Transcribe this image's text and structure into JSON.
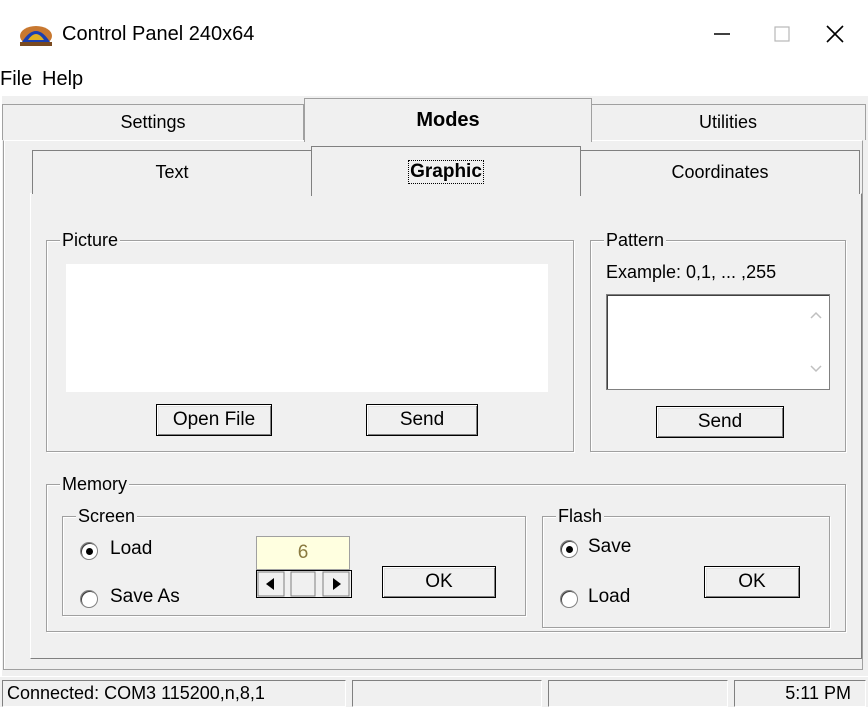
{
  "window": {
    "title": "Control Panel 240x64",
    "icon": "app-logo-icon",
    "controls": {
      "minimize": "—",
      "maximize": "☐",
      "close": "✕"
    }
  },
  "menu": {
    "items": [
      "File",
      "Help"
    ]
  },
  "outer_tabs": [
    {
      "label": "Settings",
      "active": false
    },
    {
      "label": "Modes",
      "active": true
    },
    {
      "label": "Utilities",
      "active": false
    }
  ],
  "inner_tabs": [
    {
      "label": "Text",
      "active": false
    },
    {
      "label": "Graphic",
      "active": true
    },
    {
      "label": "Coordinates",
      "active": false
    }
  ],
  "picture": {
    "label": "Picture",
    "open_file_button": "Open File",
    "send_button": "Send"
  },
  "pattern": {
    "label": "Pattern",
    "example": "Example: 0,1, ... ,255",
    "send_button": "Send"
  },
  "memory": {
    "label": "Memory",
    "screen": {
      "label": "Screen",
      "load_label": "Load",
      "save_as_label": "Save As",
      "load_checked": true,
      "value": "6",
      "ok_button": "OK"
    },
    "flash": {
      "label": "Flash",
      "save_label": "Save",
      "load_label": "Load",
      "save_checked": true,
      "ok_button": "OK"
    }
  },
  "status": {
    "connection": "Connected: COM3 115200,n,8,1",
    "pane2": "",
    "pane3": "",
    "time": "5:11 PM"
  }
}
